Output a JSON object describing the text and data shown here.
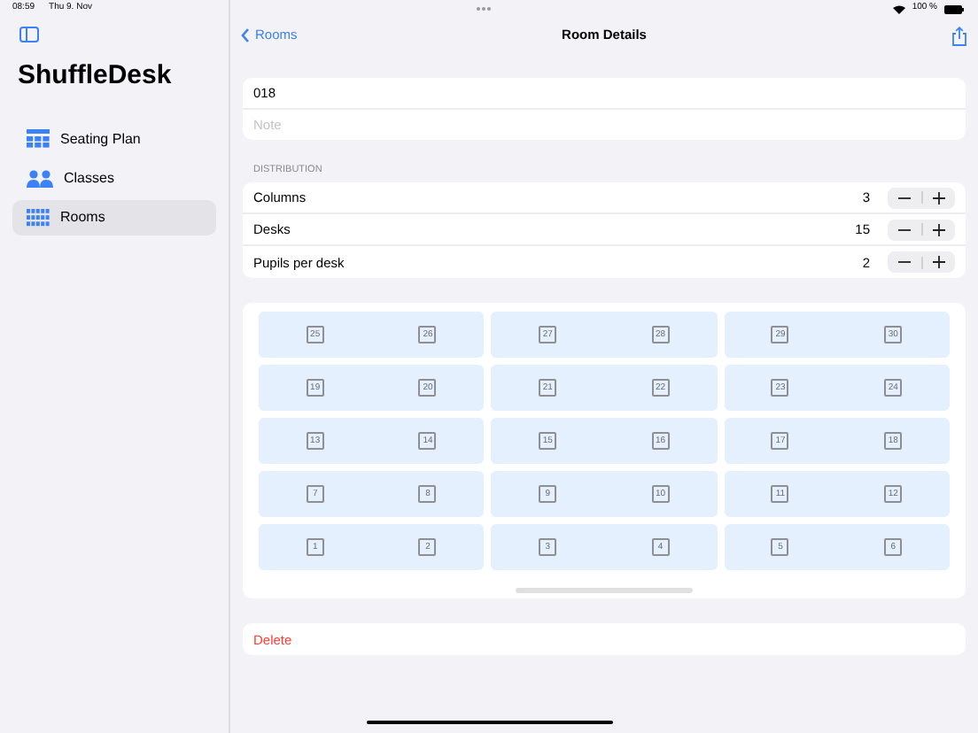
{
  "status_bar": {
    "time": "08:59",
    "date": "Thu 9. Nov",
    "battery": "100 %"
  },
  "sidebar": {
    "title": "ShuffleDesk",
    "items": [
      {
        "label": "Seating Plan",
        "selected": false
      },
      {
        "label": "Classes",
        "selected": false
      },
      {
        "label": "Rooms",
        "selected": true
      }
    ]
  },
  "nav": {
    "back": "Rooms",
    "title": "Room Details"
  },
  "room": {
    "name": "018",
    "note_placeholder": "Note"
  },
  "distribution": {
    "header": "DISTRIBUTION",
    "rows": [
      {
        "label": "Columns",
        "value": "3"
      },
      {
        "label": "Desks",
        "value": "15"
      },
      {
        "label": "Pupils per desk",
        "value": "2"
      }
    ]
  },
  "desk_grid": [
    [
      [
        "25",
        "26"
      ],
      [
        "27",
        "28"
      ],
      [
        "29",
        "30"
      ]
    ],
    [
      [
        "19",
        "20"
      ],
      [
        "21",
        "22"
      ],
      [
        "23",
        "24"
      ]
    ],
    [
      [
        "13",
        "14"
      ],
      [
        "15",
        "16"
      ],
      [
        "17",
        "18"
      ]
    ],
    [
      [
        "7",
        "8"
      ],
      [
        "9",
        "10"
      ],
      [
        "11",
        "12"
      ]
    ],
    [
      [
        "1",
        "2"
      ],
      [
        "3",
        "4"
      ],
      [
        "5",
        "6"
      ]
    ]
  ],
  "delete_label": "Delete"
}
